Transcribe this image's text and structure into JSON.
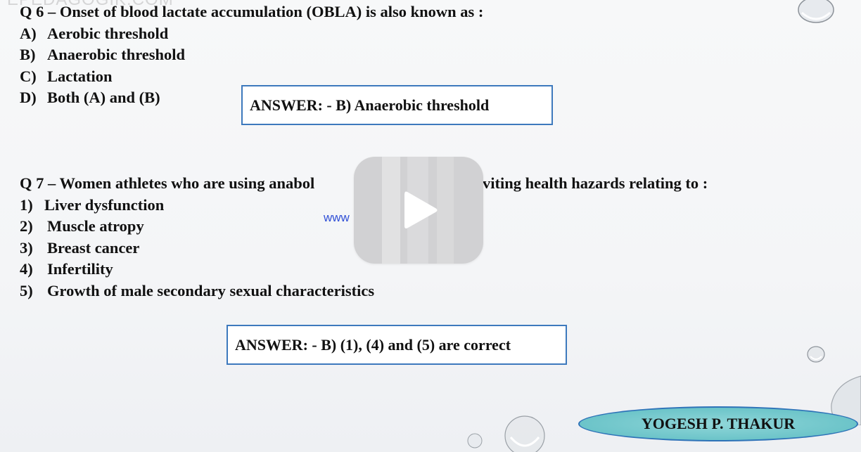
{
  "watermark": {
    "top_text": "EPEDAGOGIK.COM",
    "mid_text": "www"
  },
  "q6": {
    "question": "Q 6 – Onset of blood lactate accumulation (OBLA) is also known as :",
    "options": [
      {
        "key": "A)",
        "text": "Aerobic threshold"
      },
      {
        "key": "B)",
        "text": "Anaerobic threshold"
      },
      {
        "key": "C)",
        "text": "Lactation"
      },
      {
        "key": "D)",
        "text": "Both (A) and (B)"
      }
    ],
    "answer": "ANSWER: - B) Anaerobic threshold"
  },
  "q7": {
    "question_left": "Q 7 – Women athletes who are using anabol",
    "question_right": "viting health hazards relating to :",
    "options": [
      {
        "key": "1)",
        "text": "Liver dysfunction"
      },
      {
        "key": "2)",
        "text": "Muscle atropy"
      },
      {
        "key": "3)",
        "text": "Breast cancer"
      },
      {
        "key": "4)",
        "text": "Infertility"
      },
      {
        "key": "5)",
        "text": "Growth of male secondary sexual characteristics"
      }
    ],
    "answer": "ANSWER: - B) (1), (4) and (5) are correct"
  },
  "author": {
    "name": "YOGESH P. THAKUR"
  },
  "player": {
    "play_icon": "play-icon"
  },
  "colors": {
    "answer_border": "#3d79bd",
    "author_fill": "#6cc4c9",
    "author_border": "#2e73b8",
    "watermark_link": "#2f4fd6"
  }
}
